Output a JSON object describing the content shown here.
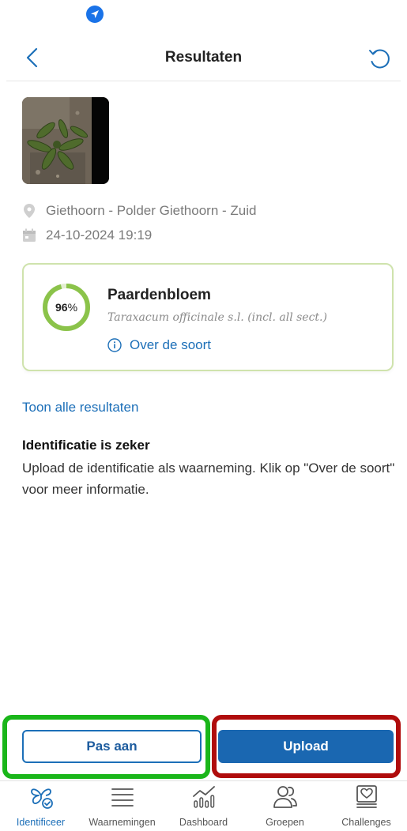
{
  "status_bar": {
    "icon": "location-arrow-icon"
  },
  "header": {
    "title": "Resultaten",
    "back_icon": "chevron-left-icon",
    "refresh_icon": "refresh-icon"
  },
  "observation": {
    "location": "Giethoorn - Polder Giethoorn - Zuid",
    "datetime": "24-10-2024 19:19"
  },
  "result": {
    "confidence_value": "96",
    "confidence_unit": "%",
    "confidence_fraction": 0.96,
    "species_name": "Paardenbloem",
    "scientific_name": "Taraxacum officinale s.l. (incl. all sect.)",
    "about_label": "Over de soort"
  },
  "show_all_label": "Toon alle resultaten",
  "certainty": {
    "title": "Identificatie is zeker",
    "text": "Upload de identificatie als waarneming. Klik op \"Over de soort\" voor meer informatie."
  },
  "actions": {
    "edit_label": "Pas aan",
    "upload_label": "Upload"
  },
  "nav": {
    "items": [
      {
        "label": "Identificeer",
        "icon": "butterfly-check-icon",
        "active": true
      },
      {
        "label": "Waarnemingen",
        "icon": "list-icon",
        "active": false
      },
      {
        "label": "Dashboard",
        "icon": "chart-icon",
        "active": false
      },
      {
        "label": "Groepen",
        "icon": "people-icon",
        "active": false
      },
      {
        "label": "Challenges",
        "icon": "badge-heart-icon",
        "active": false
      }
    ]
  },
  "colors": {
    "accent": "#1c6fb8",
    "upload_button": "#1a67b1",
    "confidence_ring": "#8bc34a",
    "card_border": "#cfe3ad",
    "highlight_green": "#1ab61a",
    "highlight_red": "#b00c0c"
  }
}
